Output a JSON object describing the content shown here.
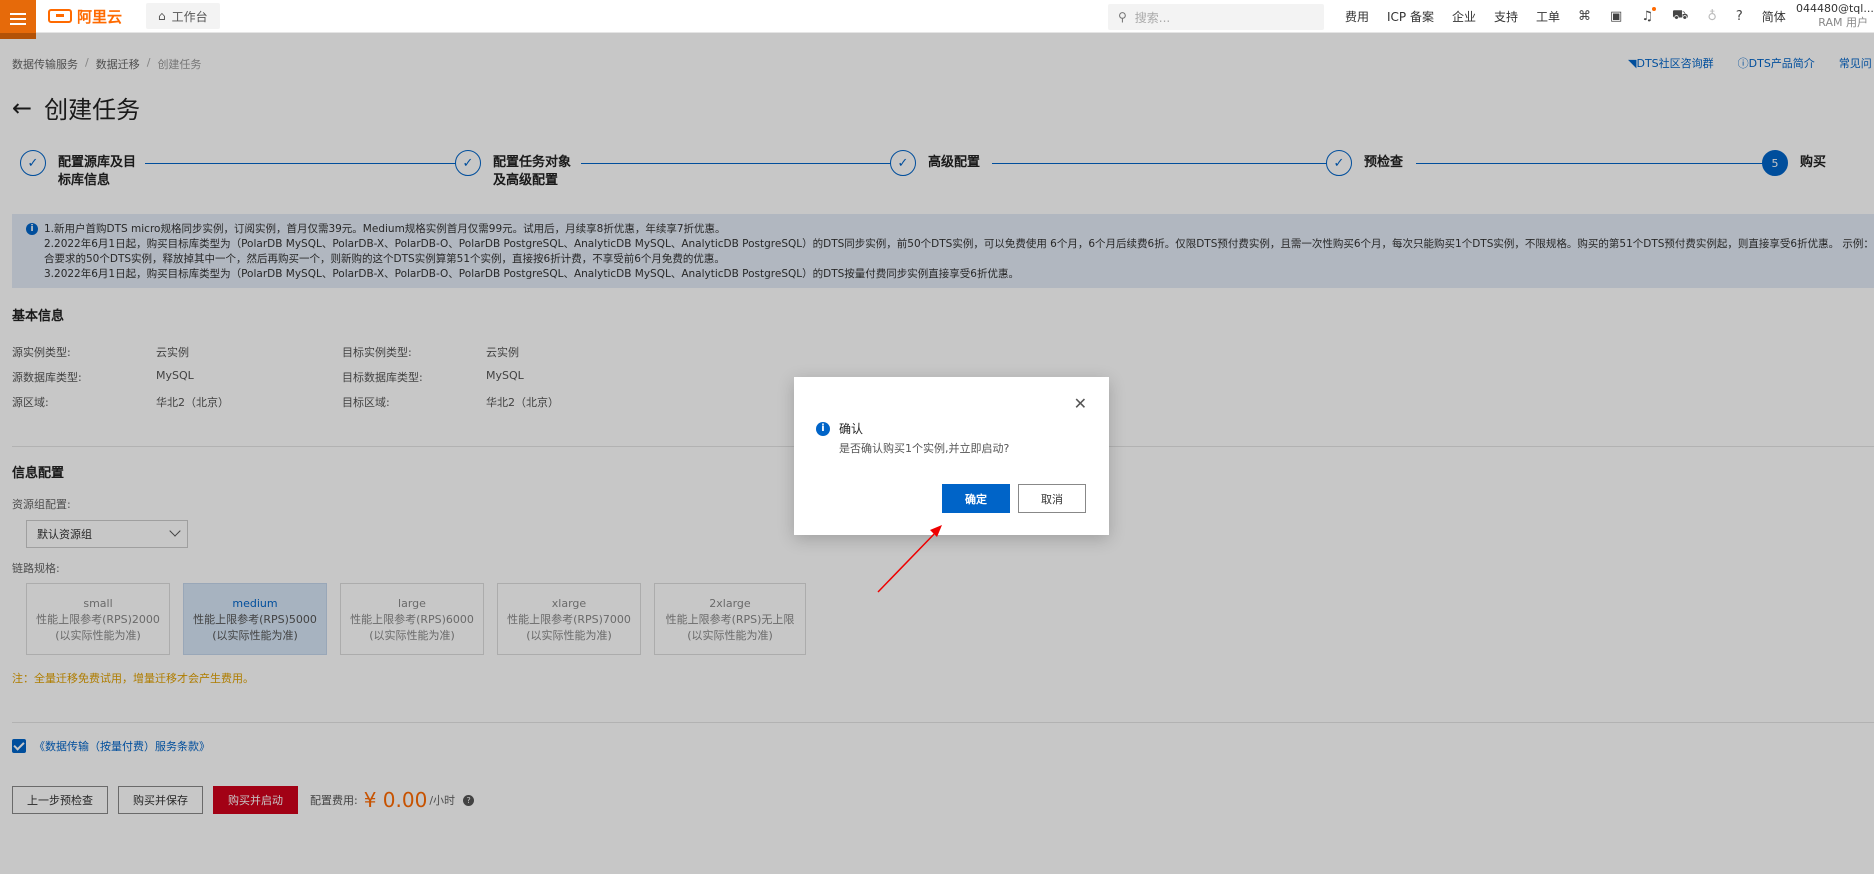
{
  "topbar": {
    "logo_text": "阿里云",
    "workbench": "工作台",
    "search_placeholder": "搜索...",
    "nav_items": [
      "费用",
      "ICP 备案",
      "企业",
      "支持",
      "工单"
    ],
    "lang": "简体",
    "user_line1": "044480@tql...",
    "user_line2": "RAM 用户"
  },
  "breadcrumb": [
    "数据传输服务",
    "数据迁移",
    "创建任务"
  ],
  "toplinks": [
    "DTS社区咨询群",
    "DTS产品简介",
    "常见问"
  ],
  "page_title": "创建任务",
  "steps": [
    {
      "label_line1": "配置源库及目",
      "label_line2": "标库信息",
      "state": "done"
    },
    {
      "label_line1": "配置任务对象",
      "label_line2": "及高级配置",
      "state": "done"
    },
    {
      "label_line1": "高级配置",
      "label_line2": "",
      "state": "done"
    },
    {
      "label_line1": "预检查",
      "label_line2": "",
      "state": "done"
    },
    {
      "label_line1": "购买",
      "label_line2": "",
      "state": "active",
      "number": "5"
    }
  ],
  "notice": {
    "line1": "1.新用户首购DTS micro规格同步实例，订阅实例，首月仅需39元。Medium规格实例首月仅需99元。试用后，月续享8折优惠，年续享7折优惠。",
    "line2": "2.2022年6月1日起，购买目标库类型为（PolarDB MySQL、PolarDB-X、PolarDB-O、PolarDB PostgreSQL、AnalyticDB MySQL、AnalyticDB PostgreSQL）的DTS同步实例，前50个DTS实例，可以免费使用 6个月，6个月后续费6折。仅限DTS预付费实例，且需一次性购买6个月，每次只能购买1个DTS实例，不限规格。购买的第51个DTS预付费实例起，则直接享受6折优惠。 示例：已购买符",
    "line3": "合要求的50个DTS实例，释放掉其中一个，然后再购买一个，则新购的这个DTS实例算第51个实例，直接按6折计费，不享受前6个月免费的优惠。",
    "line4": "3.2022年6月1日起，购买目标库类型为（PolarDB MySQL、PolarDB-X、PolarDB-O、PolarDB PostgreSQL、AnalyticDB MySQL、AnalyticDB PostgreSQL）的DTS按量付费同步实例直接享受6折优惠。"
  },
  "basic_info": {
    "title": "基本信息",
    "rows": [
      {
        "k1": "源实例类型:",
        "v1": "云实例",
        "k2": "目标实例类型:",
        "v2": "云实例"
      },
      {
        "k1": "源数据库类型:",
        "v1": "MySQL",
        "k2": "目标数据库类型:",
        "v2": "MySQL"
      },
      {
        "k1": "源区域:",
        "v1": "华北2（北京）",
        "k2": "目标区域:",
        "v2": "华北2（北京）"
      }
    ]
  },
  "config": {
    "title": "信息配置",
    "resource_group_label": "资源组配置:",
    "resource_group_value": "默认资源组",
    "spec_label": "链路规格:",
    "specs": [
      {
        "name": "small",
        "l2": "性能上限参考(RPS)2000",
        "l3": "(以实际性能为准)"
      },
      {
        "name": "medium",
        "l2": "性能上限参考(RPS)5000",
        "l3": "(以实际性能为准)"
      },
      {
        "name": "large",
        "l2": "性能上限参考(RPS)6000",
        "l3": "(以实际性能为准)"
      },
      {
        "name": "xlarge",
        "l2": "性能上限参考(RPS)7000",
        "l3": "(以实际性能为准)"
      },
      {
        "name": "2xlarge",
        "l2": "性能上限参考(RPS)无上限",
        "l3": "(以实际性能为准)"
      }
    ],
    "selected_spec": "medium",
    "note": "注：全量迁移免费试用，增量迁移才会产生费用。"
  },
  "agreement": "《数据传输（按量付费）服务条款》",
  "bottom": {
    "prev_btn": "上一步预检查",
    "save_btn": "购买并保存",
    "start_btn": "购买并启动",
    "fee_label": "配置费用:",
    "fee_value": "¥ 0.00",
    "fee_unit": "/小时"
  },
  "dialog": {
    "title": "确认",
    "message": "是否确认购买1个实例,并立即启动?",
    "ok": "确定",
    "cancel": "取消"
  },
  "colors": {
    "primary": "#0064c8",
    "brand": "#ff6a00",
    "danger": "#d0021b"
  }
}
